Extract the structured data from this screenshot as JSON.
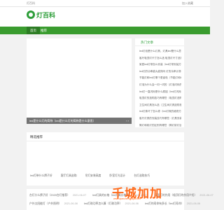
{
  "topbar": {
    "site_label": "灯百科",
    "favorite_label": "加入收藏"
  },
  "header": {
    "logo_text": "灯百科"
  },
  "nav": {
    "home": "首页",
    "page": "推荐"
  },
  "banner": {
    "caption": "led是什么灯的简称（led是什么灯的简称是什么意思）",
    "arrows": "‹ ›"
  },
  "hot": {
    "title": "热门文章",
    "items": [
      "led灯泡是什么灯具，灯具led是什么意思",
      "客厅吸顶灯尺寸怎么选 吸顶灯尺寸选择",
      "家居led灯带怎么安装（led灯带安装方法图解）",
      "led灯的功率越大越亮吗 灯的功率计算方法",
      "节能灯和led灯哪个更省电（节能灯和led灯的区别）",
      "灯泡为什么会一闪一闪的（灯泡闪烁的原因分析）",
      "led灯一直闪烁是什么原因（led灯闪烁的原因）",
      "吸顶灯的选购技巧有哪些（吸顶灯选购技巧介绍）",
      "卫生间灯具怎么选（卫生间灯具选购指南）",
      "led灯珠坏了怎么修（led灯珠的维修方法）",
      "客厅灯具的安装技巧有哪些（灯具安装）",
      "筒灯和射灯的区别有哪些（筒灯射灯区别）"
    ]
  },
  "recommend": {
    "title": "精选推荐",
    "items": [
      "led灯带什么牌子好",
      "客厅灯具选购",
      "吊灯安装高度",
      "卧室灯光设计",
      "台灯选购技巧"
    ]
  },
  "articles": {
    "rows": [
      [
        {
          "title": "台灯什么牌子好（2020台灯推荐）",
          "date": "2021-06-07"
        },
        {
          "title": "led灯具的价格（led灯具价格表）",
          "date": "2021-06-07"
        },
        {
          "title": "吸顶灯的作用（吸顶灯的作用介绍）",
          "date": "2021-06-07"
        }
      ],
      [
        {
          "title": "户外太阳能灯（户外照明）",
          "date": "2021-06-06"
        },
        {
          "title": "led灯珠功率怎么算（灯珠功率）",
          "date": "2021-06-06"
        },
        {
          "title": "led灯的寿命有多长（led灯寿命）",
          "date": "2021-06-06"
        }
      ]
    ]
  },
  "watermark": {
    "text": "千城加加",
    "sub": "www.qianchengjiajia.com"
  },
  "colors": {
    "brand_green": "#3a9c2f",
    "accent_orange": "#ff6a1a"
  }
}
